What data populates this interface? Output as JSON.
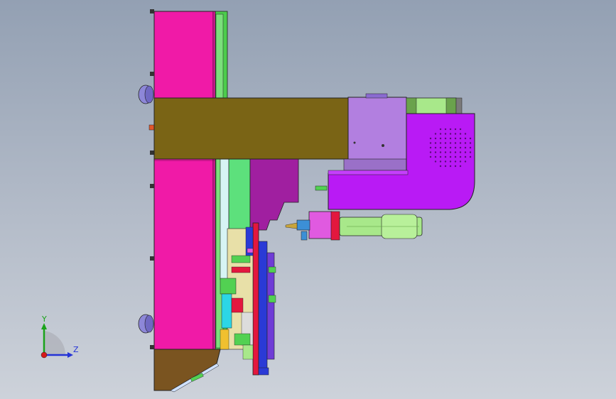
{
  "viewport": {
    "background_top": "#93a0b3",
    "background_bottom": "#cdd2da"
  },
  "model": {
    "description_colors": {
      "plate_magenta": "#f01aa7",
      "beam_olive": "#7a6415",
      "bracket_violet": "#b27fe0",
      "motor_housing_purple": "#b91af5",
      "cylinder_green": "#a8e88a",
      "base_brown": "#7a5420",
      "frame_green": "#52d152",
      "block_pink": "#e05ae0",
      "red_plate": "#e3173e"
    }
  },
  "triad": {
    "y_label": "Y",
    "z_label": "Z",
    "y_color": "#1aa31a",
    "z_color": "#2433d6",
    "origin_color": "#d61a1a"
  }
}
